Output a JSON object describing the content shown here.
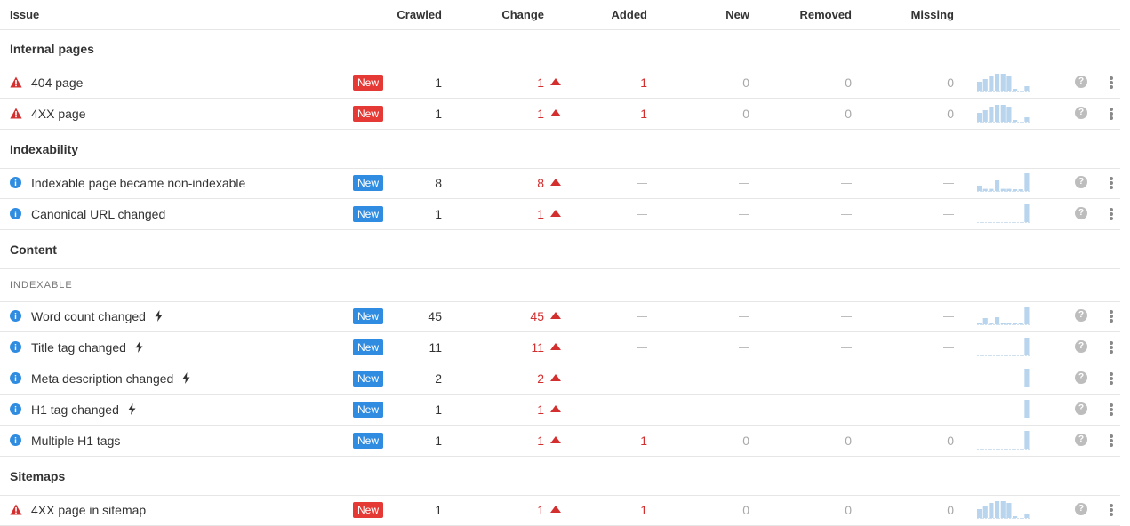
{
  "header": {
    "issue": "Issue",
    "crawled": "Crawled",
    "change": "Change",
    "added": "Added",
    "new": "New",
    "removed": "Removed",
    "missing": "Missing"
  },
  "icons": {
    "error": "warning-triangle-icon",
    "info": "info-circle-icon",
    "bolt": "lightning-bolt-icon",
    "up": "arrow-up-triangle-icon",
    "help": "question-mark-icon",
    "more": "kebab-menu-icon"
  },
  "colors": {
    "red_text": "#d32f2f",
    "badge_red": "#e53935",
    "badge_blue": "#2f8ce0",
    "sparkline": "#b9d5ee",
    "muted": "#a8a8a8"
  },
  "sections": [
    {
      "title": "Internal pages",
      "groups": [
        {
          "subheader": "",
          "issues": [
            {
              "name": "404 page",
              "severity": "error",
              "bolt": false,
              "badge": "New",
              "crawled": "1",
              "change": "1",
              "added": "1",
              "new": "0",
              "removed": "0",
              "missing": "0",
              "trend": [
                0.5,
                0.65,
                0.85,
                0.95,
                0.95,
                0.85,
                0.1,
                0,
                0.25
              ]
            },
            {
              "name": "4XX page",
              "severity": "error",
              "bolt": false,
              "badge": "New",
              "crawled": "1",
              "change": "1",
              "added": "1",
              "new": "0",
              "removed": "0",
              "missing": "0",
              "trend": [
                0.5,
                0.65,
                0.85,
                0.95,
                0.95,
                0.85,
                0.1,
                0,
                0.25
              ]
            }
          ]
        }
      ]
    },
    {
      "title": "Indexability",
      "groups": [
        {
          "subheader": "",
          "issues": [
            {
              "name": "Indexable page became non-indexable",
              "severity": "info",
              "bolt": false,
              "badge": "New",
              "crawled": "8",
              "change": "8",
              "added": "",
              "new": "",
              "removed": "",
              "missing": "",
              "trend": [
                0.3,
                0.12,
                0.12,
                0.6,
                0.12,
                0.12,
                0.1,
                0.1,
                1.0
              ]
            },
            {
              "name": "Canonical URL changed",
              "severity": "info",
              "bolt": false,
              "badge": "New",
              "crawled": "1",
              "change": "1",
              "added": "",
              "new": "",
              "removed": "",
              "missing": "",
              "trend": [
                0,
                0,
                0,
                0,
                0,
                0,
                0,
                0,
                1.0
              ]
            }
          ]
        }
      ]
    },
    {
      "title": "Content",
      "groups": [
        {
          "subheader": "INDEXABLE",
          "issues": [
            {
              "name": "Word count changed",
              "severity": "info",
              "bolt": true,
              "badge": "New",
              "crawled": "45",
              "change": "45",
              "added": "",
              "new": "",
              "removed": "",
              "missing": "",
              "trend": [
                0.1,
                0.35,
                0.1,
                0.4,
                0.1,
                0.1,
                0.1,
                0.1,
                1.0
              ]
            },
            {
              "name": "Title tag changed",
              "severity": "info",
              "bolt": true,
              "badge": "New",
              "crawled": "11",
              "change": "11",
              "added": "",
              "new": "",
              "removed": "",
              "missing": "",
              "trend": [
                0,
                0,
                0,
                0,
                0,
                0,
                0,
                0,
                1.0
              ]
            },
            {
              "name": "Meta description changed",
              "severity": "info",
              "bolt": true,
              "badge": "New",
              "crawled": "2",
              "change": "2",
              "added": "",
              "new": "",
              "removed": "",
              "missing": "",
              "trend": [
                0,
                0,
                0,
                0,
                0,
                0,
                0,
                0,
                1.0
              ]
            },
            {
              "name": "H1 tag changed",
              "severity": "info",
              "bolt": true,
              "badge": "New",
              "crawled": "1",
              "change": "1",
              "added": "",
              "new": "",
              "removed": "",
              "missing": "",
              "trend": [
                0,
                0,
                0,
                0,
                0,
                0,
                0,
                0,
                1.0
              ]
            },
            {
              "name": "Multiple H1 tags",
              "severity": "info",
              "bolt": false,
              "badge": "New",
              "crawled": "1",
              "change": "1",
              "added": "1",
              "new": "0",
              "removed": "0",
              "missing": "0",
              "trend": [
                0,
                0,
                0,
                0,
                0,
                0,
                0,
                0,
                1.0
              ]
            }
          ]
        }
      ]
    },
    {
      "title": "Sitemaps",
      "groups": [
        {
          "subheader": "",
          "issues": [
            {
              "name": "4XX page in sitemap",
              "severity": "error",
              "bolt": false,
              "badge": "New",
              "crawled": "1",
              "change": "1",
              "added": "1",
              "new": "0",
              "removed": "0",
              "missing": "0",
              "trend": [
                0.5,
                0.65,
                0.85,
                0.95,
                0.95,
                0.85,
                0.1,
                0,
                0.25
              ]
            }
          ]
        }
      ]
    }
  ]
}
